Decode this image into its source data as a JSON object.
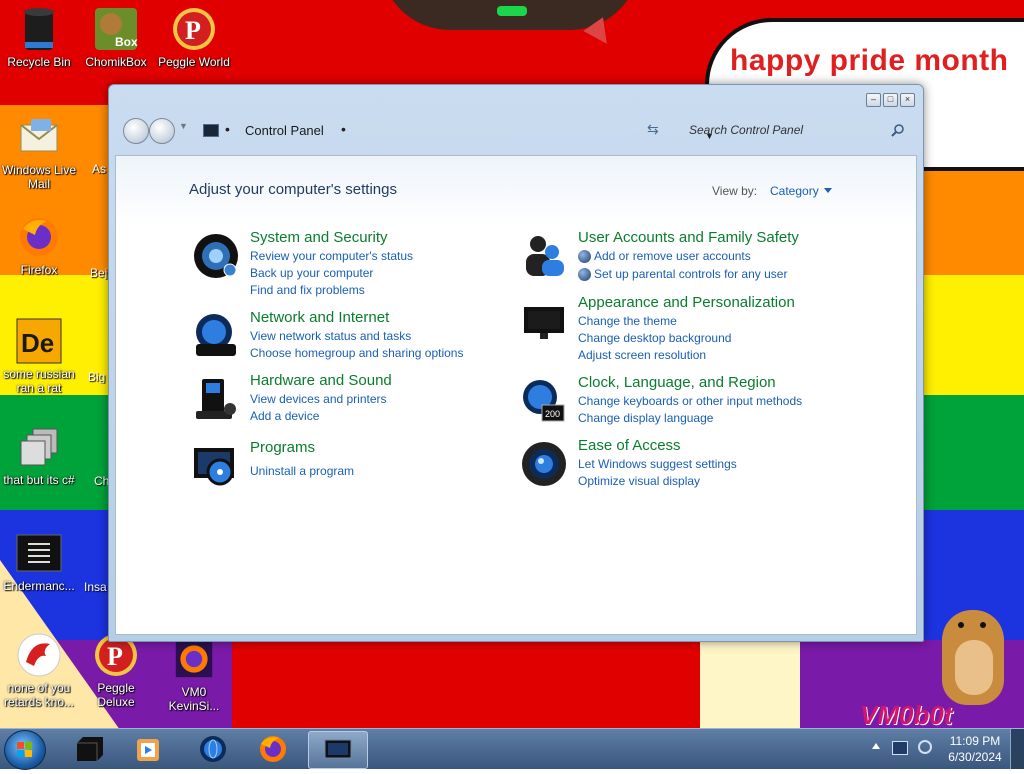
{
  "wallpaper": {
    "speech_text": "happy pride month",
    "watermark": "VM0b0t"
  },
  "desktop": {
    "icons": [
      {
        "label": "Recycle Bin",
        "icon": "recycle-bin-icon"
      },
      {
        "label": "ChomikBox",
        "icon": "chomikbox-icon",
        "badge": "Box"
      },
      {
        "label": "Peggle World of Warcraft",
        "icon": "peggle-icon"
      },
      {
        "label": "Windows Live Mail",
        "icon": "mail-icon"
      },
      {
        "label": "Firefox",
        "icon": "firefox-icon"
      },
      {
        "label": "some russian ran a rat",
        "icon": "de-icon",
        "badge": "De"
      },
      {
        "label": "that but its c#",
        "icon": "windows-stack-icon"
      },
      {
        "label": "Endermanc...",
        "icon": "terminal-icon"
      },
      {
        "label": "none of you retards kno...",
        "icon": "dragon-icon"
      },
      {
        "label": "Peggle Deluxe",
        "icon": "peggle-icon"
      },
      {
        "label": "VM0 KevinSi...",
        "icon": "firefox-icon"
      }
    ],
    "partial_labels": [
      "As",
      "Bej D",
      "Big D",
      "Ch D",
      "Insa D"
    ]
  },
  "window": {
    "caption_buttons": [
      "minimize",
      "maximize",
      "close"
    ],
    "address": "Control Panel",
    "search_placeholder": "Search Control Panel",
    "heading": "Adjust your computer's settings",
    "view_by_label": "View by:",
    "view_by_value": "Category",
    "categories": [
      {
        "title": "System and Security",
        "icon": "system-security-icon",
        "links": [
          "Review your computer's status",
          "Back up your computer",
          "Find and fix problems"
        ]
      },
      {
        "title": "Network and Internet",
        "icon": "network-icon",
        "links": [
          "View network status and tasks",
          "Choose homegroup and sharing options"
        ]
      },
      {
        "title": "Hardware and Sound",
        "icon": "hardware-sound-icon",
        "links": [
          "View devices and printers",
          "Add a device"
        ]
      },
      {
        "title": "Programs",
        "icon": "programs-icon",
        "links": [
          "Uninstall a program"
        ]
      },
      {
        "title": "User Accounts and Family Safety",
        "icon": "user-accounts-icon",
        "links": [
          "Add or remove user accounts",
          "Set up parental controls for any user"
        ]
      },
      {
        "title": "Appearance and Personalization",
        "icon": "appearance-icon",
        "links": [
          "Change the theme",
          "Change desktop background",
          "Adjust screen resolution"
        ]
      },
      {
        "title": "Clock, Language, and Region",
        "icon": "clock-region-icon",
        "badge": "200",
        "links": [
          "Change keyboards or other input methods",
          "Change display language"
        ]
      },
      {
        "title": "Ease of Access",
        "icon": "ease-of-access-icon",
        "links": [
          "Let Windows suggest settings",
          "Optimize visual display"
        ]
      }
    ]
  },
  "taskbar": {
    "items": [
      "computer-icon",
      "media-player-icon",
      "globe-icon",
      "firefox-icon",
      "control-panel-icon"
    ],
    "time": "11:09 PM",
    "date": "6/30/2024"
  },
  "colors": {
    "link": "#1a5fb4",
    "category_title": "#0a7d2c",
    "speech_text": "#e02020"
  }
}
